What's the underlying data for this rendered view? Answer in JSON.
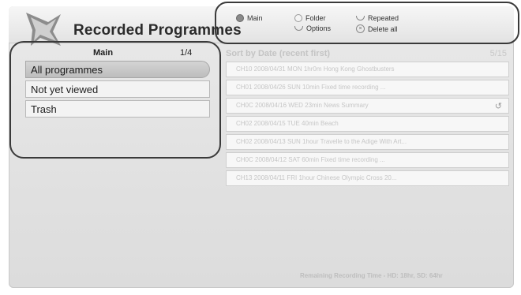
{
  "header": {
    "title": "Recorded Programmes",
    "legend": {
      "main": "Main",
      "folder": "Folder",
      "options": "Options",
      "repeated": "Repeated",
      "delete_all": "Delete all"
    }
  },
  "left_panel": {
    "heading": "Main",
    "page": "1/4",
    "items": [
      {
        "label": "All programmes",
        "selected": true
      },
      {
        "label": "Not yet viewed",
        "selected": false
      },
      {
        "label": "Trash",
        "selected": false
      }
    ]
  },
  "right_panel": {
    "heading": "Sort by Date (recent first)",
    "page": "5/15",
    "rows": [
      {
        "text": "CH10  2008/04/31  MON   1hr0m   Hong Kong Ghostbusters"
      },
      {
        "text": "CH01  2008/04/26  SUN   10min   Fixed time recording ..."
      },
      {
        "text": "CH0C  2008/04/16  WED   23min   News Summary",
        "icon": "repeat-icon"
      },
      {
        "text": "CH02  2008/04/15  TUE   40min   Beach"
      },
      {
        "text": "CH02  2008/04/13  SUN   1hour   Travelle to the Adige With Art..."
      },
      {
        "text": "CH0C  2008/04/12  SAT   60min   Fixed time recording ..."
      },
      {
        "text": "CH13  2008/04/11  FRI   1hour   Chinese Olympic Cross 20..."
      }
    ]
  },
  "footer": {
    "remaining": "Remaining Recording Time - HD: 18hr, SD: 64hr"
  },
  "colors": {
    "outline": "#3a3a3a",
    "selected_item": "#c4c4c4"
  }
}
